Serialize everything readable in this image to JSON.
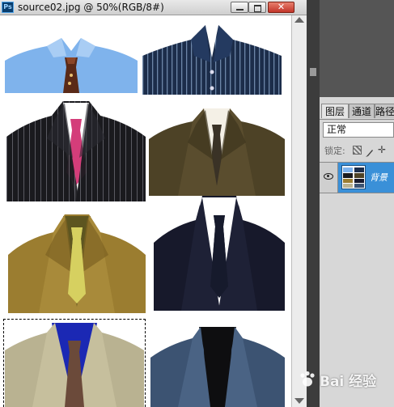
{
  "document": {
    "title": "source02.jpg @ 50%(RGB/8#)",
    "app_logo_text": "Ps"
  },
  "canvas": {
    "images": [
      {
        "name": "light-blue-shirt",
        "shirt": "#7fb3ec",
        "jacket": null,
        "tie": "#5a2a18"
      },
      {
        "name": "navy-striped-shirt",
        "shirt": "#1c2d4a",
        "jacket": null,
        "tie": null
      },
      {
        "name": "black-pinstripe-suit",
        "shirt": "#ffffff",
        "jacket": "#1a1a1e",
        "tie": "#d43d7a"
      },
      {
        "name": "olive-suit",
        "shirt": "#f4f0e6",
        "jacket": "#4d4226",
        "tie": "#3a3226"
      },
      {
        "name": "mustard-tweed-suit",
        "shirt": "#5d5520",
        "jacket": "#9b7d30",
        "tie": "#d6d060"
      },
      {
        "name": "navy-suit",
        "shirt": "#ffffff",
        "jacket": "#17192b",
        "tie": "#161a2c"
      },
      {
        "name": "khaki-suit-blue-shirt",
        "shirt": "#1b28b4",
        "jacket": "#b9b291",
        "tie": "#6b4a3a"
      },
      {
        "name": "blue-tweed-blazer",
        "shirt": "#0e0e10",
        "jacket": "#3c5372",
        "tie": null
      }
    ]
  },
  "layers_panel": {
    "tabs": [
      "图层",
      "通道",
      "路径"
    ],
    "blend_mode": "正常",
    "lock_label": "锁定:",
    "layer_name": "背景"
  },
  "watermark": {
    "text": "Bai 经验"
  },
  "colors": {
    "selection_blue": "#3a90d8",
    "chrome_gray": "#d7d7d7",
    "dark_bg": "#565656"
  }
}
